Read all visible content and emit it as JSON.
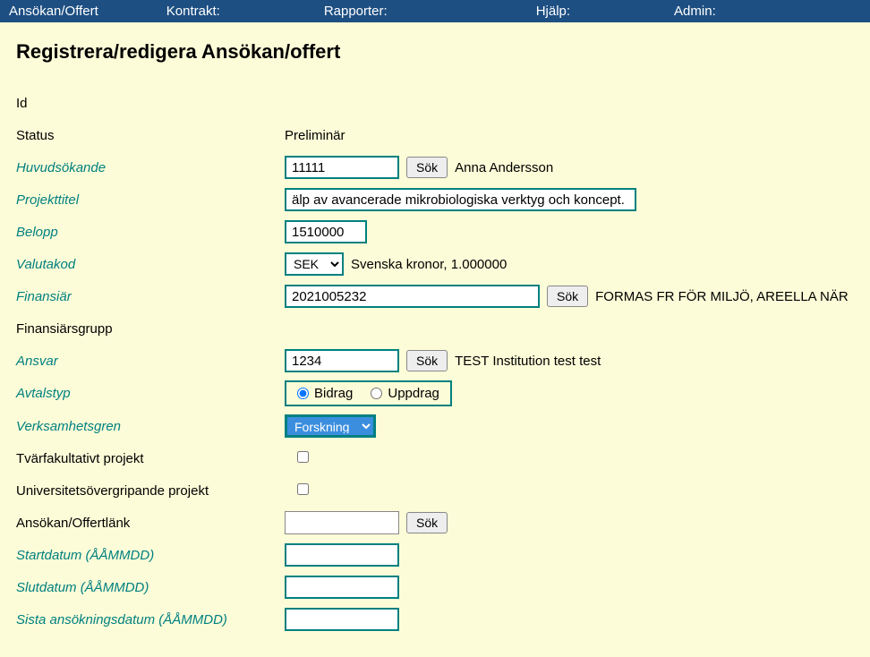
{
  "nav": {
    "items": [
      "Ansökan/Offert",
      "Kontrakt:",
      "Rapporter:",
      "Hjälp:",
      "Admin:"
    ]
  },
  "page": {
    "title": "Registrera/redigera Ansökan/offert"
  },
  "form": {
    "id_label": "Id",
    "status_label": "Status",
    "status_value": "Preliminär",
    "huvudsokande_label": "Huvudsökande",
    "huvudsokande_value": "11111",
    "huvudsokande_name": "Anna Andersson",
    "projekttitel_label": "Projekttitel",
    "projekttitel_value": "älp av avancerade mikrobiologiska verktyg och koncept.",
    "belopp_label": "Belopp",
    "belopp_value": "1510000",
    "valutakod_label": "Valutakod",
    "valutakod_value": "SEK",
    "valutakod_desc": "Svenska kronor, 1.000000",
    "finansiar_label": "Finansiär",
    "finansiar_value": "2021005232",
    "finansiar_desc": "FORMAS FR FÖR MILJÖ, AREELLA NÄR",
    "finansiarsgrupp_label": "Finansiärsgrupp",
    "ansvar_label": "Ansvar",
    "ansvar_value": "1234",
    "ansvar_desc": "TEST Institution test test",
    "avtalstyp_label": "Avtalstyp",
    "avtalstyp_bidrag": "Bidrag",
    "avtalstyp_uppdrag": "Uppdrag",
    "verksamhetsgren_label": "Verksamhetsgren",
    "verksamhetsgren_value": "Forskning",
    "tvarfak_label": "Tvärfakultativt projekt",
    "univover_label": "Universitetsövergripande projekt",
    "offertlank_label": "Ansökan/Offertlänk",
    "startdatum_label": "Startdatum (ÅÅMMDD)",
    "slutdatum_label": "Slutdatum (ÅÅMMDD)",
    "sistaansokan_label": "Sista ansökningsdatum (ÅÅMMDD)",
    "sok_label": "Sök"
  }
}
